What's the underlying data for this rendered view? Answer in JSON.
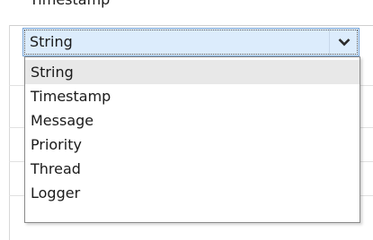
{
  "header": {
    "column_label": "Timestamp"
  },
  "combo": {
    "selected_value": "String",
    "arrow_icon": "chevron-down-icon"
  },
  "dropdown": {
    "options": [
      "String",
      "Timestamp",
      "Message",
      "Priority",
      "Thread",
      "Logger"
    ],
    "highlighted_index": 0
  },
  "colors": {
    "combo_background": "#dcecfc",
    "combo_border": "#7aa6d8",
    "highlight": "#e8e8e8"
  }
}
